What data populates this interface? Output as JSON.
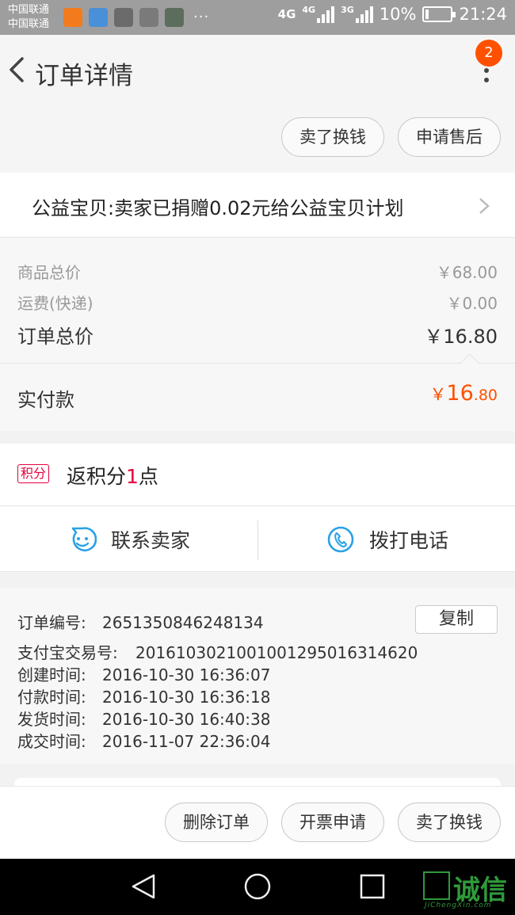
{
  "status_bar": {
    "carrier_1": "中国联通",
    "carrier_2": "中国联通",
    "more": "···",
    "network_1": "4G",
    "network_2": "4G",
    "network_3": "3G",
    "battery": "10%",
    "time": "21:24"
  },
  "header": {
    "title": "订单详情",
    "badge": "2"
  },
  "top_actions": {
    "sell_exchange": "卖了换钱",
    "after_sale": "申请售后"
  },
  "charity": {
    "text": "公益宝贝:卖家已捐赠0.02元给公益宝贝计划"
  },
  "prices": {
    "goods_total_label": "商品总价",
    "goods_total_value": "￥68.00",
    "shipping_label": "运费(快递)",
    "shipping_value": "￥0.00",
    "order_total_label": "订单总价",
    "order_total_value": "￥16.80"
  },
  "paid": {
    "label": "实付款",
    "currency": "￥",
    "integer": "16",
    "decimal": ".80"
  },
  "points": {
    "tag": "积分",
    "prefix": "返积分",
    "count": "1",
    "suffix": "点"
  },
  "contact": {
    "seller": "联系卖家",
    "phone": "拨打电话"
  },
  "info": {
    "order_no_label": "订单编号:",
    "order_no": "2651350846248134",
    "copy": "复制",
    "alipay_label": "支付宝交易号:",
    "alipay_no": "2016103021001001295016314620",
    "created_label": "创建时间:",
    "created": "2016-10-30 16:36:07",
    "paid_label": "付款时间:",
    "paid_time": "2016-10-30 16:36:18",
    "shipped_label": "发货时间:",
    "shipped": "2016-10-30 16:40:38",
    "done_label": "成交时间:",
    "done": "2016-11-07 22:36:04"
  },
  "bottom_actions": {
    "delete": "删除订单",
    "invoice": "开票申请",
    "sell_exchange": "卖了换钱"
  },
  "watermark": {
    "brand": "诚信",
    "domain": "JiChengXin.com"
  },
  "colors": {
    "accent": "#ff5000",
    "points": "#e5003f",
    "contact_icon": "#2aa1e6",
    "watermark": "#2f9a3a"
  }
}
